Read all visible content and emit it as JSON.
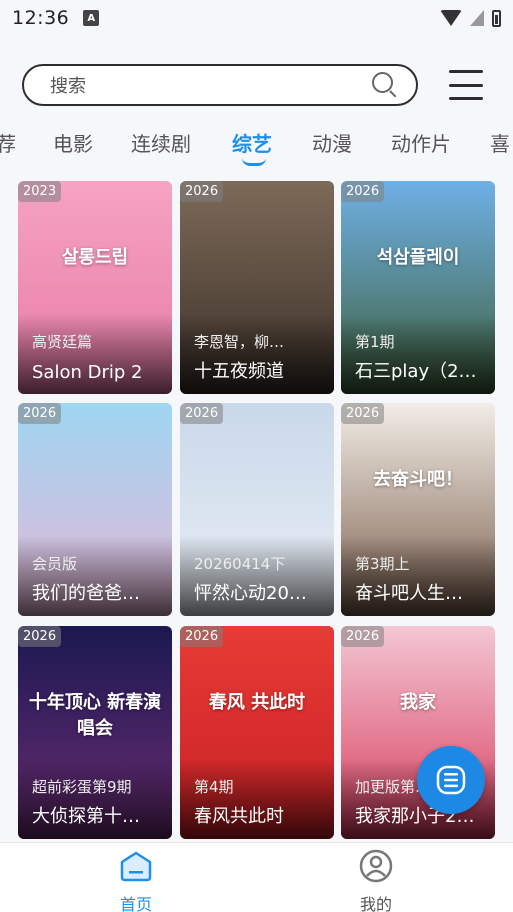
{
  "status_bar": {
    "time": "12:36",
    "app_icon_letter": "A"
  },
  "search": {
    "placeholder": "搜索"
  },
  "tabs": [
    {
      "label": "荐",
      "active": false
    },
    {
      "label": "电影",
      "active": false
    },
    {
      "label": "连续剧",
      "active": false
    },
    {
      "label": "综艺",
      "active": true
    },
    {
      "label": "动漫",
      "active": false
    },
    {
      "label": "动作片",
      "active": false
    },
    {
      "label": "喜",
      "active": false
    }
  ],
  "cards": [
    {
      "year": "2023",
      "subtitle": "高贤廷篇",
      "title": "Salon Drip 2",
      "art_text": "살롱드립",
      "color_top": "#f6a3c2",
      "color_bottom": "#e77aa6"
    },
    {
      "year": "2026",
      "subtitle": "李恩智，柳…",
      "title": "十五夜频道",
      "art_text": "",
      "color_top": "#7d6a58",
      "color_bottom": "#3a2f28"
    },
    {
      "year": "2026",
      "subtitle": "第1期",
      "title": "石三play（2…",
      "art_text": "석삼플레이",
      "color_top": "#6fb0e6",
      "color_bottom": "#3e5f3a"
    },
    {
      "year": "2026",
      "subtitle": "会员版",
      "title": "我们的爸爸…",
      "art_text": "",
      "color_top": "#9ed6f2",
      "color_bottom": "#e6b6d6"
    },
    {
      "year": "2026",
      "subtitle": "20260414下",
      "title": "怦然心动20…",
      "art_text": "",
      "color_top": "#c9d8ea",
      "color_bottom": "#e9eef5"
    },
    {
      "year": "2026",
      "subtitle": "第3期上",
      "title": "奋斗吧人生…",
      "art_text": "去奋斗吧！",
      "color_top": "#f2ede6",
      "color_bottom": "#7a5d4c"
    },
    {
      "year": "2026",
      "subtitle": "超前彩蛋第9期",
      "title": "大侦探第十…",
      "art_text": "十年顶心 新春演唱会",
      "color_top": "#1b1850",
      "color_bottom": "#6b2d74"
    },
    {
      "year": "2026",
      "subtitle": "第4期",
      "title": "春风共此时",
      "art_text": "春风 共此时",
      "color_top": "#e73b35",
      "color_bottom": "#c71f24"
    },
    {
      "year": "2026",
      "subtitle": "加更版第…",
      "title": "我家那小子2…",
      "art_text": "我家",
      "color_top": "#f3c7d3",
      "color_bottom": "#d83a5e"
    }
  ],
  "bottom_nav": [
    {
      "label": "首页",
      "icon": "home-icon",
      "active": true
    },
    {
      "label": "我的",
      "icon": "profile-icon",
      "active": false
    }
  ],
  "colors": {
    "accent": "#1e90e8",
    "fab": "#1e88e5"
  }
}
